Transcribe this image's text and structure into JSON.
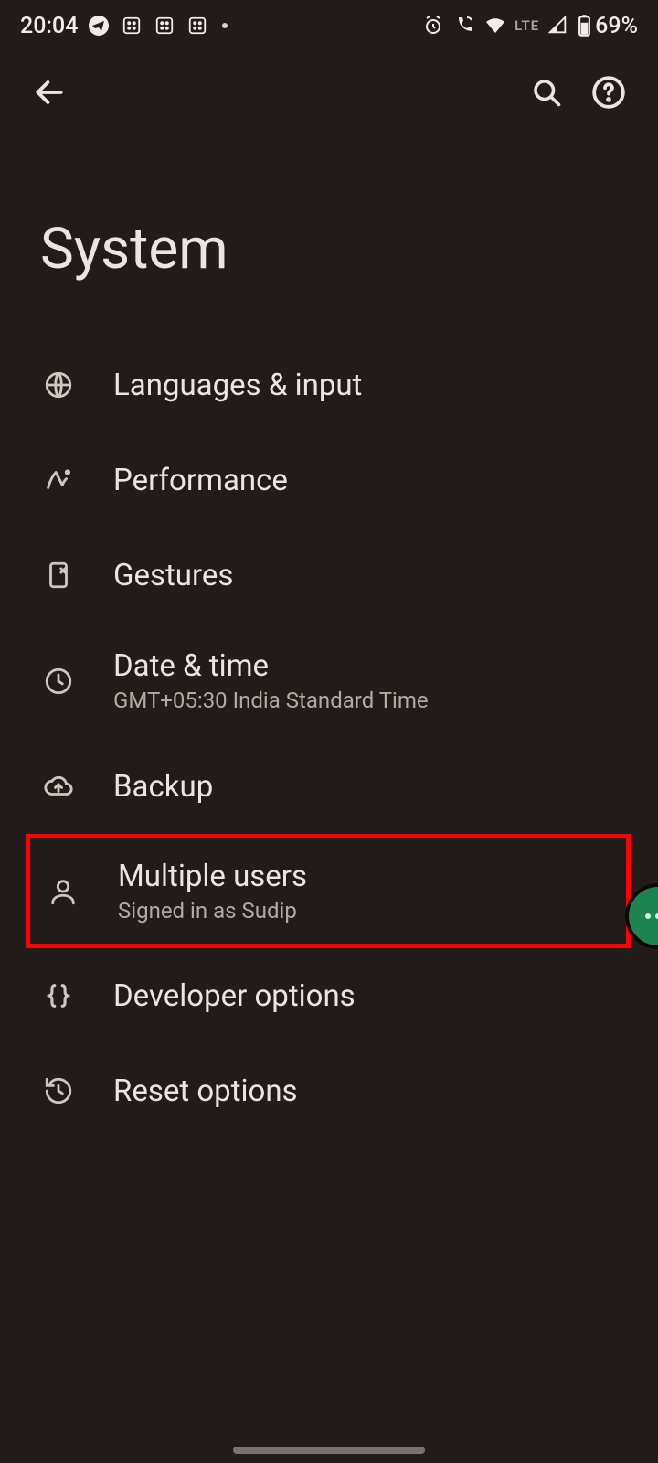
{
  "status_bar": {
    "time": "20:04",
    "network_label": "LTE",
    "battery_text": "69%"
  },
  "page": {
    "title": "System"
  },
  "items": [
    {
      "title": "Languages & input",
      "sub": ""
    },
    {
      "title": "Performance",
      "sub": ""
    },
    {
      "title": "Gestures",
      "sub": ""
    },
    {
      "title": "Date & time",
      "sub": "GMT+05:30 India Standard Time"
    },
    {
      "title": "Backup",
      "sub": ""
    },
    {
      "title": "Multiple users",
      "sub": "Signed in as Sudip"
    },
    {
      "title": "Developer options",
      "sub": ""
    },
    {
      "title": "Reset options",
      "sub": ""
    }
  ]
}
